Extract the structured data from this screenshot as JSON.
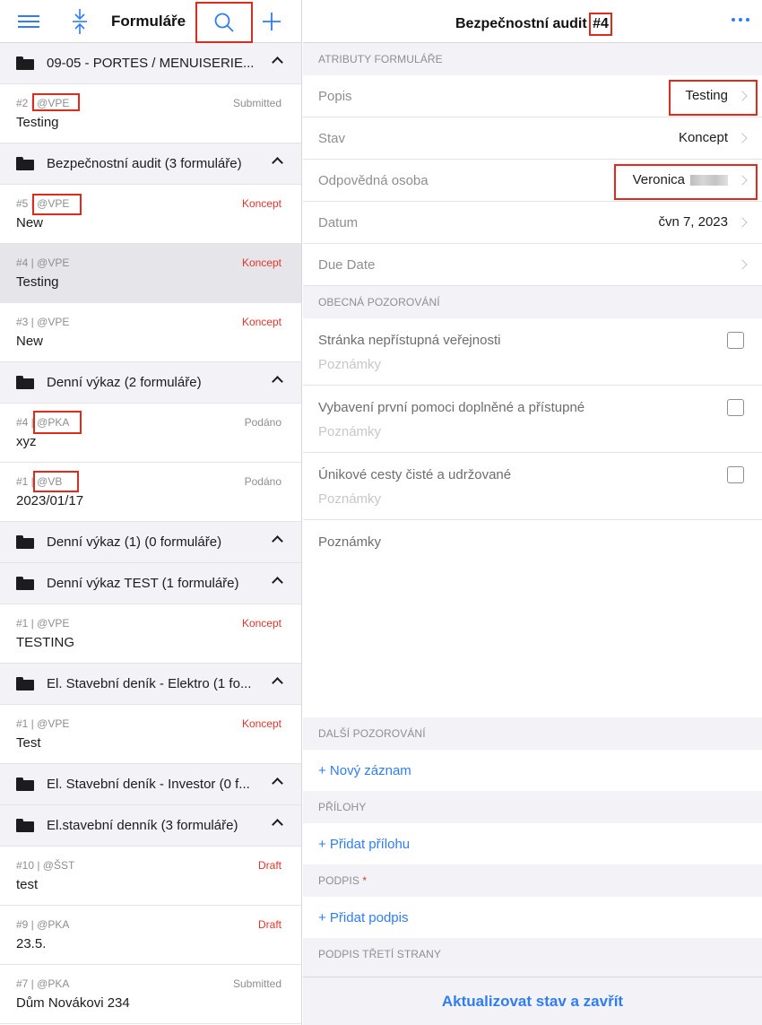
{
  "left_pane": {
    "title": "Formuláře",
    "groups": [
      {
        "label": "09-05 - PORTES / MENUISERIE...",
        "forms": [
          {
            "meta": "#2 | @VPE",
            "status": "Submitted",
            "title": "Testing"
          }
        ]
      },
      {
        "label": "Bezpečnostní audit (3 formuláře)",
        "forms": [
          {
            "meta": "#5 | @VPE",
            "status": "Koncept",
            "title": "New"
          },
          {
            "meta": "#4 | @VPE",
            "status": "Koncept",
            "title": "Testing"
          },
          {
            "meta": "#3 | @VPE",
            "status": "Koncept",
            "title": "New"
          }
        ]
      },
      {
        "label": "Denní výkaz (2 formuláře)",
        "forms": [
          {
            "meta": "#4 | @PKA",
            "status": "Podáno",
            "title": "xyz"
          },
          {
            "meta": "#1 | @VB",
            "status": "Podáno",
            "title": "2023/01/17"
          }
        ]
      },
      {
        "label": "Denní výkaz (1) (0 formuláře)",
        "forms": []
      },
      {
        "label": "Denní výkaz TEST (1 formuláře)",
        "forms": [
          {
            "meta": "#1 | @VPE",
            "status": "Koncept",
            "title": "TESTING"
          }
        ]
      },
      {
        "label": "El. Stavební deník - Elektro (1 fo...",
        "forms": [
          {
            "meta": "#1 | @VPE",
            "status": "Koncept",
            "title": "Test"
          }
        ]
      },
      {
        "label": "El. Stavební deník - Investor (0 f...",
        "forms": []
      },
      {
        "label": "El.stavební denník (3 formuláře)",
        "forms": [
          {
            "meta": "#10 | @ŠST",
            "status": "Draft",
            "title": "test"
          },
          {
            "meta": "#9 | @PKA",
            "status": "Draft",
            "title": "23.5."
          },
          {
            "meta": "#7 | @PKA",
            "status": "Submitted",
            "title": "Dům Novákovi 234"
          }
        ]
      }
    ]
  },
  "right_pane": {
    "title_prefix": "Bezpečnostní audit ",
    "title_number": "#4",
    "sections": {
      "attributes": "ATRIBUTY FORMULÁŘE",
      "general_obs": "OBECNÁ POZOROVÁNÍ",
      "further_obs": "DALŠÍ POZOROVÁNÍ",
      "attachments": "PŘÍLOHY",
      "signature": "PODPIS",
      "signature_required_mark": "*",
      "third_party_signature": "PODPIS TŘETÍ STRANY"
    },
    "attributes": {
      "popis_label": "Popis",
      "popis_value": "Testing",
      "stav_label": "Stav",
      "stav_value": "Koncept",
      "osoba_label": "Odpovědná osoba",
      "osoba_value": "Veronica",
      "datum_label": "Datum",
      "datum_value": "čvn 7, 2023",
      "due_label": "Due Date"
    },
    "observations": [
      {
        "label": "Stránka nepřístupná veřejnosti",
        "note": "Poznámky"
      },
      {
        "label": "Vybavení první pomoci doplněné a přístupné",
        "note": "Poznámky"
      },
      {
        "label": "Únikové cesty čisté a udržované",
        "note": "Poznámky"
      }
    ],
    "notes_label": "Poznámky",
    "new_record": "+ Nový záznam",
    "add_attachment": "+ Přidat přílohu",
    "add_signature": "+ Přidat podpis",
    "bottom_button": "Aktualizovat stav a zavřít"
  },
  "colors": {
    "accent": "#2f7df6",
    "status_red": "#e5342b",
    "highlight": "#e02a1c"
  },
  "icons": {
    "menu": "hamburger-icon",
    "collapse": "collapse-vertical-icon",
    "search": "search-icon",
    "add": "plus-icon",
    "more": "ellipsis-icon"
  }
}
